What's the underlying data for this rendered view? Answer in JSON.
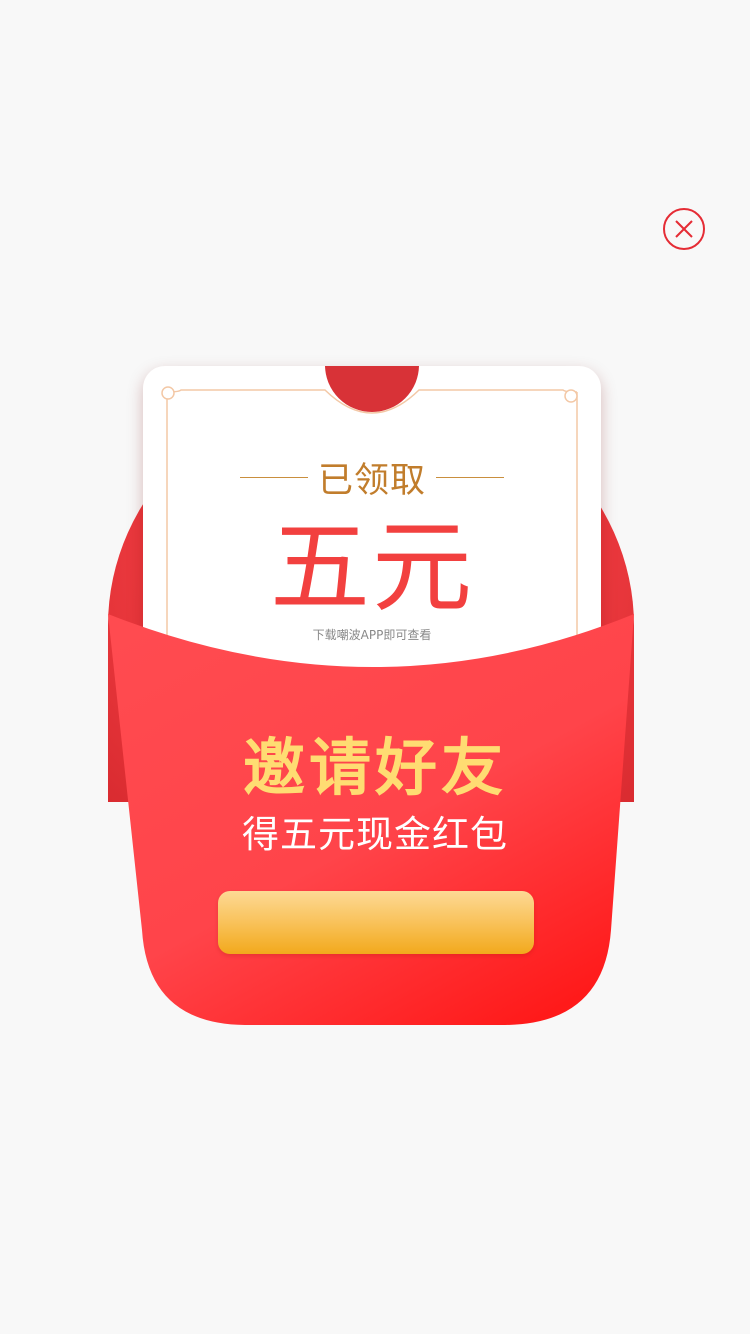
{
  "popup": {
    "claimed_label": "已领取",
    "amount": "五元",
    "download_note": "下载嘲波APP即可查看",
    "invite_title": "邀请好友",
    "invite_subtitle": "得五元现金红包",
    "cta_label": ""
  },
  "icons": {
    "close": "close-circle-icon"
  },
  "colors": {
    "page_background": "#f8f8f8",
    "envelope_red": "#ff4a4f",
    "amount_red": "#f2403f",
    "claimed_gold": "#c17d2c",
    "title_yellow": "#ffdc72",
    "button_gold": "#f9c25a",
    "close_red": "#e52c35"
  }
}
